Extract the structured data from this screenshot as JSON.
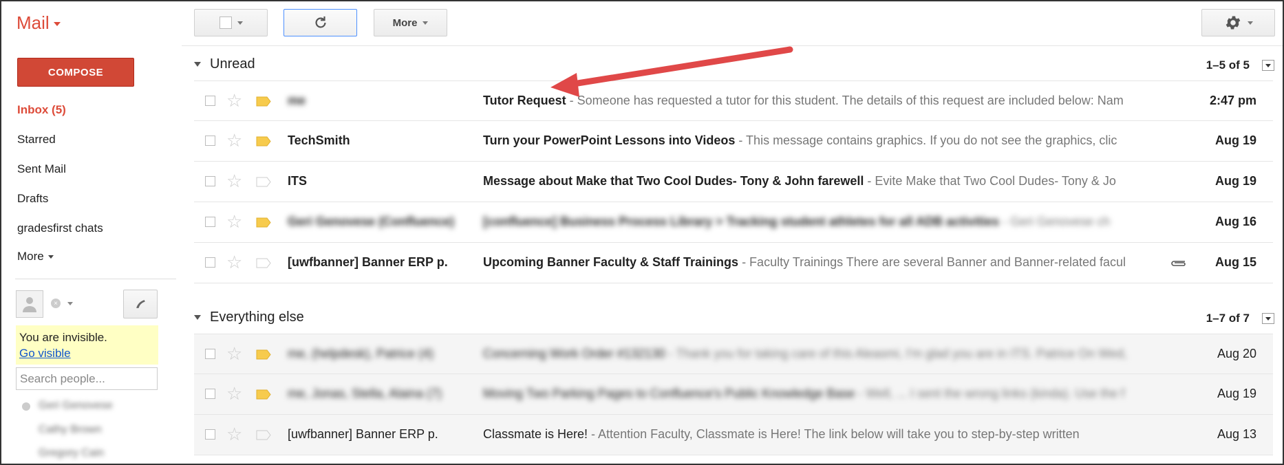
{
  "app": {
    "title": "Mail"
  },
  "toolbar": {
    "more_label": "More"
  },
  "nav": {
    "compose_label": "COMPOSE",
    "items": [
      {
        "label": "Inbox (5)",
        "active": true
      },
      {
        "label": "Starred"
      },
      {
        "label": "Sent Mail"
      },
      {
        "label": "Drafts"
      },
      {
        "label": "gradesfirst chats"
      },
      {
        "label": "More"
      }
    ]
  },
  "chat": {
    "invisible_text": "You are invisible.",
    "go_visible_label": "Go visible",
    "search_placeholder": "Search people...",
    "contacts": [
      "Geri Genovese",
      "Cathy Brown",
      "Gregory Cain"
    ]
  },
  "unread": {
    "title": "Unread",
    "range": "1–5 of 5",
    "rows": [
      {
        "sender": "me",
        "sender_blur": true,
        "subject": "Tutor Request",
        "snippet": " - Someone has requested a tutor for this student. The details of this request are included below: Nam",
        "date": "2:47 pm",
        "tag": true
      },
      {
        "sender": "TechSmith",
        "subject": "Turn your PowerPoint Lessons into Videos",
        "snippet": " - This message contains graphics. If you do not see the graphics, clic",
        "date": "Aug 19",
        "tag": true
      },
      {
        "sender": "ITS",
        "subject": "Message about Make that Two Cool Dudes- Tony & John farewell",
        "snippet": " - Evite Make that Two Cool Dudes- Tony & Jo",
        "date": "Aug 19",
        "tag": false
      },
      {
        "sender": "Geri Genovese (Confluence)",
        "sender_blur": true,
        "subject": "[confluence] Business Process Library > Tracking student athletes for all ADB activities",
        "snippet": " - Geri Genovese ch",
        "subject_blur": true,
        "date": "Aug 16",
        "tag": true
      },
      {
        "sender": "[uwfbanner] Banner ERP p.",
        "subject": "Upcoming Banner Faculty & Staff Trainings",
        "snippet": " - Faculty Trainings There are several Banner and Banner-related facul",
        "date": "Aug 15",
        "tag": false,
        "attachment": true
      }
    ]
  },
  "everything": {
    "title": "Everything else",
    "range": "1–7 of 7",
    "rows": [
      {
        "sender": "me, (helpdesk), Patrice (4)",
        "sender_blur": true,
        "subject": "Concerning Work Order #132130",
        "snippet": " - Thank you for taking care of this Aleasmi, I'm glad you are in ITS. Patrice On Wed,",
        "subject_blur": true,
        "date": "Aug 20",
        "tag": true
      },
      {
        "sender": "me, Jonas, Stella, Alaina (7)",
        "sender_blur": true,
        "subject": "Moving Two Parking Pages to Confluence's Public Knowledge Base",
        "snippet": " - Well, ... I sent the wrong links (kinda). Use the f",
        "subject_blur": true,
        "date": "Aug 19",
        "tag": true
      },
      {
        "sender": "[uwfbanner] Banner ERP p.",
        "subject": "Classmate is Here!",
        "snippet": " - Attention Faculty, Classmate is Here! The link below will take you to step-by-step written",
        "date": "Aug 13",
        "tag": false
      }
    ]
  },
  "colors": {
    "brand": "#dd4b39",
    "compose": "#d14836",
    "tag": "#f7cb4d",
    "link": "#1155cc",
    "annotation_arrow": "#e04848"
  },
  "icons": [
    "caret-down-icon",
    "refresh-icon",
    "gear-icon",
    "star-icon",
    "label-tag-icon",
    "paperclip-icon",
    "avatar-icon",
    "phone-icon",
    "status-icon"
  ]
}
